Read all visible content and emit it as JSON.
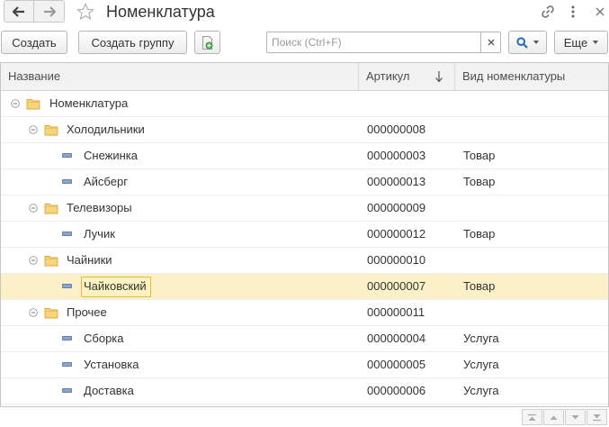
{
  "window": {
    "title": "Номенклатура"
  },
  "toolbar": {
    "create_label": "Создать",
    "create_group_label": "Создать группу",
    "search_placeholder": "Поиск (Ctrl+F)",
    "more_label": "Еще"
  },
  "table": {
    "columns": [
      "Название",
      "Артикул",
      "Вид номенклатуры"
    ],
    "rows": [
      {
        "name": "Номенклатура",
        "article": "",
        "kind": "",
        "type": "group",
        "level": 0,
        "selected": false
      },
      {
        "name": "Холодильники",
        "article": "000000008",
        "kind": "",
        "type": "group",
        "level": 1,
        "selected": false
      },
      {
        "name": "Снежинка",
        "article": "000000003",
        "kind": "Товар",
        "type": "item",
        "level": 2,
        "selected": false
      },
      {
        "name": "Айсберг",
        "article": "000000013",
        "kind": "Товар",
        "type": "item",
        "level": 2,
        "selected": false
      },
      {
        "name": "Телевизоры",
        "article": "000000009",
        "kind": "",
        "type": "group",
        "level": 1,
        "selected": false
      },
      {
        "name": "Лучик",
        "article": "000000012",
        "kind": "Товар",
        "type": "item",
        "level": 2,
        "selected": false
      },
      {
        "name": "Чайники",
        "article": "000000010",
        "kind": "",
        "type": "group",
        "level": 1,
        "selected": false
      },
      {
        "name": "Чайковский",
        "article": "000000007",
        "kind": "Товар",
        "type": "item",
        "level": 2,
        "selected": true
      },
      {
        "name": "Прочее",
        "article": "000000011",
        "kind": "",
        "type": "group",
        "level": 1,
        "selected": false
      },
      {
        "name": "Сборка",
        "article": "000000004",
        "kind": "Услуга",
        "type": "item",
        "level": 2,
        "selected": false
      },
      {
        "name": "Установка",
        "article": "000000005",
        "kind": "Услуга",
        "type": "item",
        "level": 2,
        "selected": false
      },
      {
        "name": "Доставка",
        "article": "000000006",
        "kind": "Услуга",
        "type": "item",
        "level": 2,
        "selected": false
      }
    ]
  },
  "colors": {
    "selected_row": "#fbf0c7",
    "selected_cell_border": "#e8b93c",
    "folder": "#f2c14e",
    "search_accent": "#2a6bc4",
    "add_icon": "#3aa03a"
  },
  "icons": {
    "back": "arrow-left-icon",
    "forward": "arrow-right-icon",
    "favorite": "star-icon",
    "link": "link-icon",
    "menu": "more-vertical-icon",
    "close": "close-icon",
    "add": "add-document-icon",
    "search": "search-icon",
    "clear": "close-icon",
    "folder": "folder-icon",
    "item": "item-icon",
    "collapse": "collapse-icon",
    "sort": "sort-down-icon"
  }
}
